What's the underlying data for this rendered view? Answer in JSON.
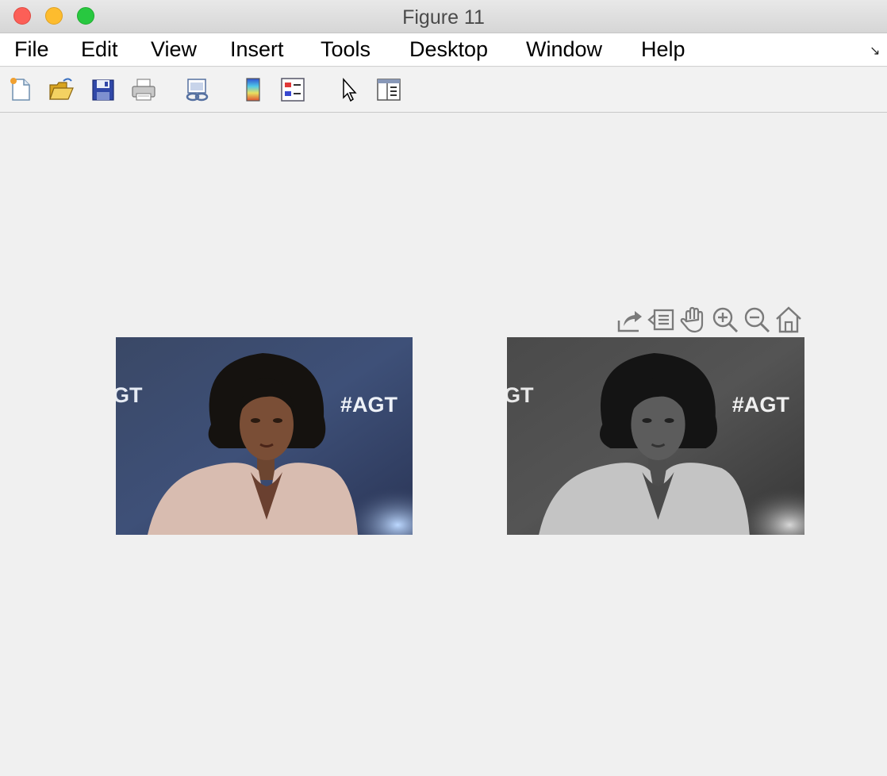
{
  "window": {
    "title": "Figure 11"
  },
  "menubar": {
    "items": [
      "File",
      "Edit",
      "View",
      "Insert",
      "Tools",
      "Desktop",
      "Window",
      "Help"
    ]
  },
  "toolbar": {
    "buttons": [
      "new-figure-icon",
      "open-file-icon",
      "save-icon",
      "print-icon",
      "link-plot-icon",
      "insert-colorbar-icon",
      "insert-legend-icon",
      "edit-plot-icon",
      "property-inspector-icon"
    ]
  },
  "axes_toolbar": {
    "buttons": [
      "export-icon",
      "brush-data-icon",
      "pan-icon",
      "zoom-in-icon",
      "zoom-out-icon",
      "restore-view-icon"
    ]
  },
  "images": {
    "left": {
      "overlay_text_right": "#AGT",
      "overlay_text_left": "GT",
      "mode": "color"
    },
    "right": {
      "overlay_text_right": "#AGT",
      "overlay_text_left": "GT",
      "mode": "grayscale"
    }
  }
}
